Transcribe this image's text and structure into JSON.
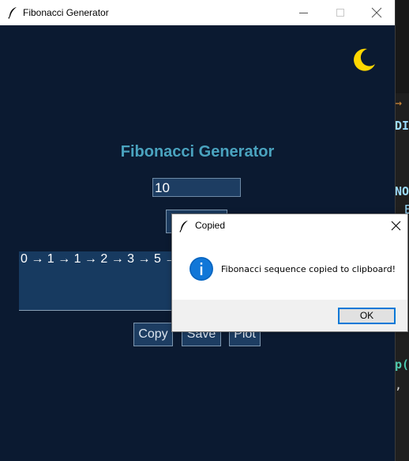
{
  "window": {
    "title": "Fibonacci Generator",
    "icon": "feather-icon",
    "controls": [
      "minimize-icon",
      "maximize-icon",
      "close-icon"
    ]
  },
  "app": {
    "theme_icon": "moon-icon",
    "heading": "Fibonacci Generator",
    "count_value": "10",
    "output_text": "0 → 1 → 1 → 2 → 3 → 5 →",
    "buttons": {
      "copy": "Copy",
      "save": "Save",
      "plot": "Plot"
    }
  },
  "dialog": {
    "title": "Copied",
    "icon": "info-icon",
    "message": "Fibonacci sequence copied to clipboard!",
    "ok_label": "OK"
  },
  "background_editor": {
    "fragments": [
      "→",
      "DI",
      "NO",
      "E",
      "p(",
      ","
    ]
  },
  "colors": {
    "app_bg": "#0b1a31",
    "heading": "#4aa3bf",
    "widget_bg": "#1d3d62",
    "moon": "#ffd700",
    "info_blue": "#1177d8",
    "focus_blue": "#0078d7"
  }
}
